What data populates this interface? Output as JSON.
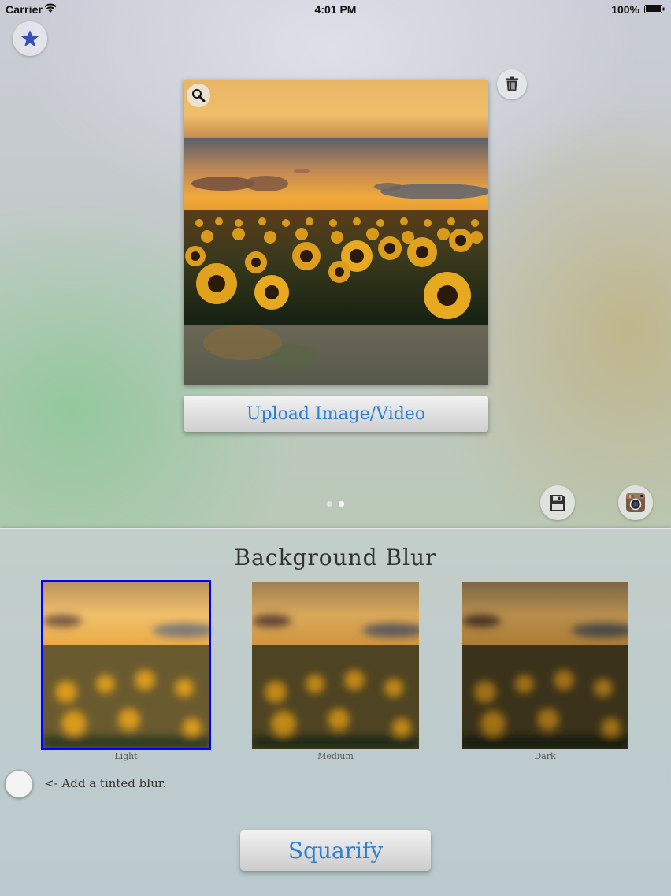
{
  "status_bar": {
    "carrier": "Carrier",
    "time": "4:01 PM",
    "battery": "100%"
  },
  "toolbar": {
    "favorites_icon": "star-icon",
    "trash_icon": "trash-icon",
    "zoom_icon": "magnifier-icon",
    "save_icon": "floppy-disk-icon",
    "instagram_icon": "instagram-icon"
  },
  "preview": {
    "upload_label": "Upload Image/Video"
  },
  "pager": {
    "pages": 2,
    "current": 2
  },
  "blur_panel": {
    "title": "Background Blur",
    "options": [
      {
        "label": "Light",
        "selected": true
      },
      {
        "label": "Medium",
        "selected": false
      },
      {
        "label": "Dark",
        "selected": false
      }
    ],
    "tint_label": "<- Add a tinted blur.",
    "tint_enabled": false,
    "squarify_label": "Squarify"
  },
  "colors": {
    "accent": "#2b7fd6",
    "selection": "#0000ff"
  }
}
